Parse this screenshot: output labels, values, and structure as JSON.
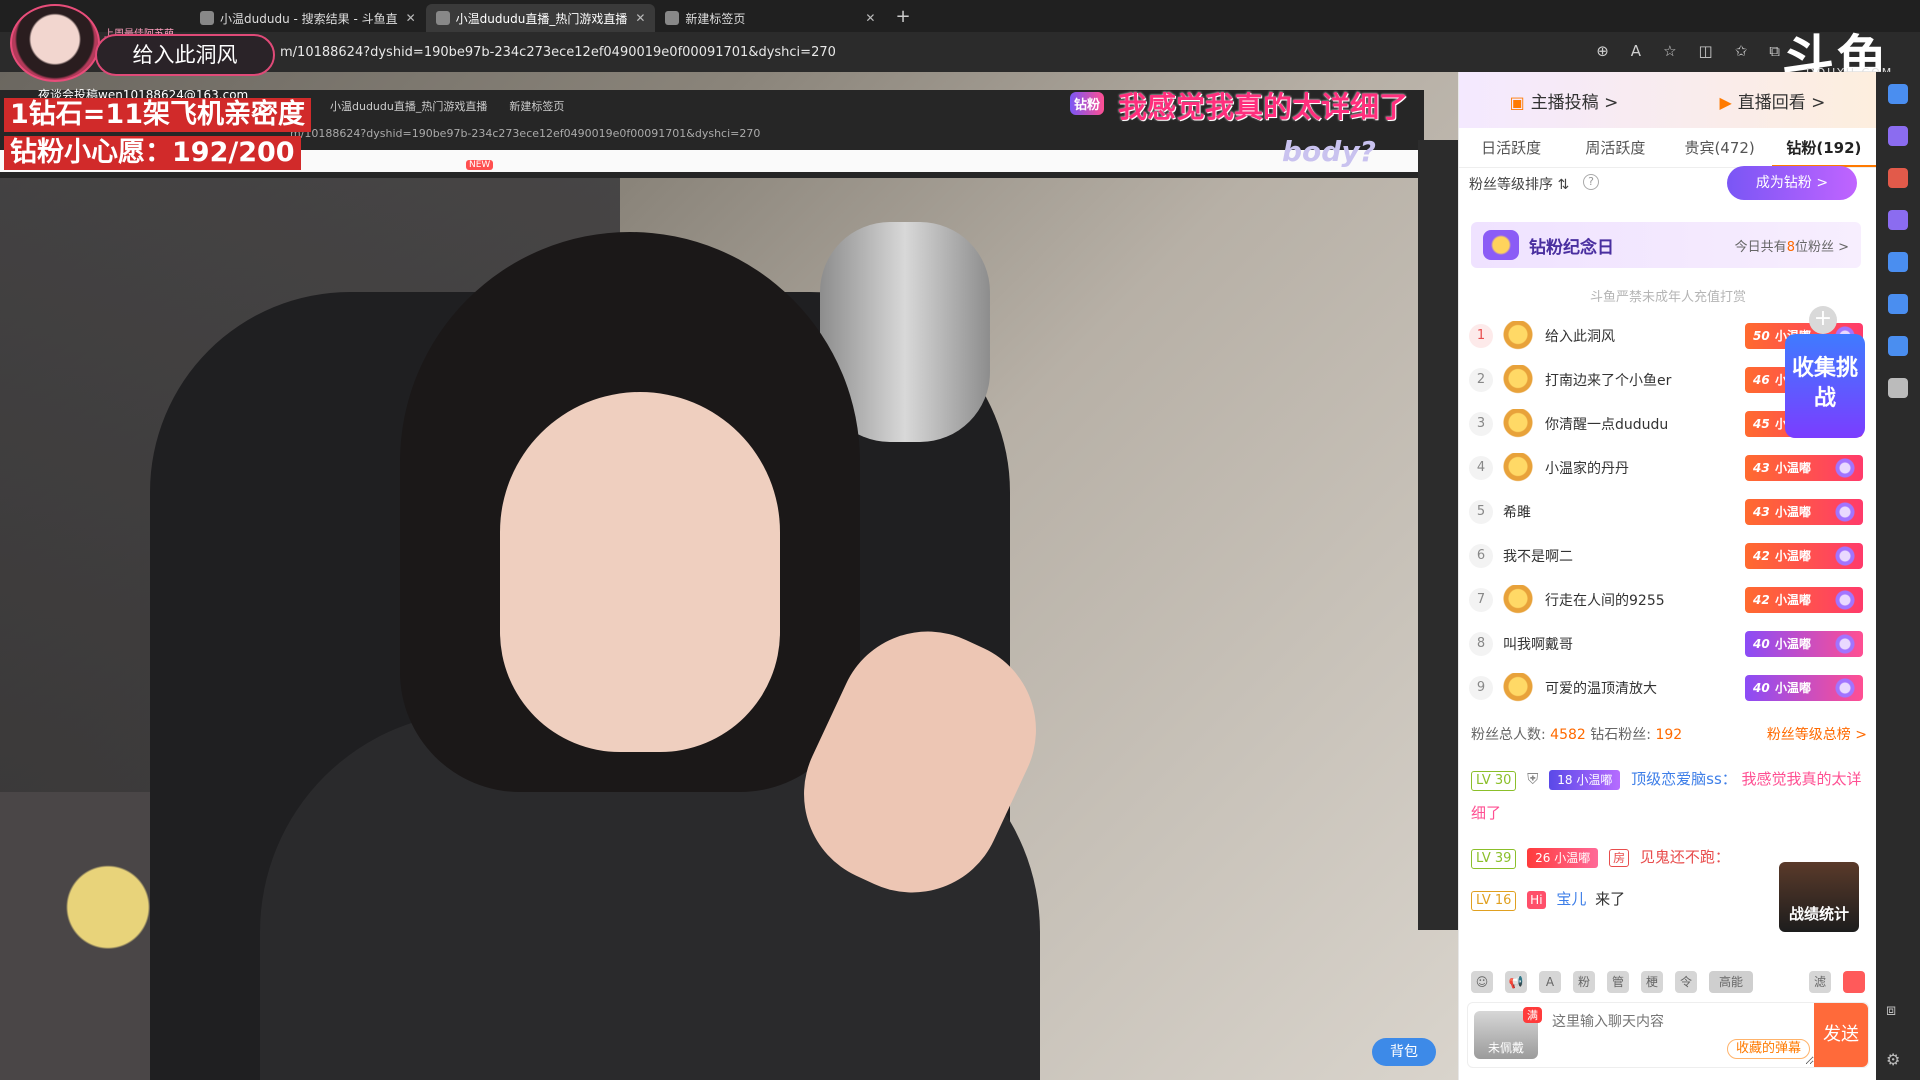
{
  "browser": {
    "tabs": [
      {
        "label": "小温dududu - 搜索结果 - 斗鱼直"
      },
      {
        "label": "小温dududu直播_热门游戏直播"
      },
      {
        "label": "新建标签页"
      }
    ],
    "new_tab": "+",
    "url": "m/10188624?dyshid=190be97b-234c273ece12ef0490019e0f00091701&dyshci=270"
  },
  "inner_browser": {
    "tabs": [
      "小温dududu直播_热门游戏直播",
      "新建标签页"
    ],
    "url": "m/10188624?dyshid=190be97b-234c273ece12ef0490019e0f00091701&dyshci=270",
    "new_badge": "NEW",
    "logo": "body?"
  },
  "overlay": {
    "name": "给入此洞风",
    "caption": "上周最佳阿苏萌",
    "email": "夜谈会投稿wen10188624@163.com",
    "promo_line1": "1钻石=11架飞机亲密度",
    "promo_line2": "钻粉小心愿：192/200",
    "danmu_badge": "钻粉",
    "danmu": "我感觉我真的太详细了",
    "brand_logo": "斗鱼",
    "brand_sub": "DOUYU.COM"
  },
  "video_controls": {
    "bag": "背包"
  },
  "panel": {
    "head": {
      "post": "主播投稿 >",
      "replay": "直播回看 >"
    },
    "tabs": [
      {
        "label": "日活跃度",
        "active": false
      },
      {
        "label": "周活跃度",
        "active": false
      },
      {
        "label": "贵宾(472)",
        "active": false
      },
      {
        "label": "钻粉(192)",
        "active": true
      }
    ],
    "rank_sort": "粉丝等级排序 ⇅",
    "help": "?",
    "become_button": "成为钻粉 >",
    "anniversary": {
      "title": "钻粉纪念日",
      "count_prefix": "今日共有",
      "count": "8",
      "count_suffix": "位粉丝 >"
    },
    "minor_warning": "斗鱼严禁未成年人充值打赏",
    "collect_widget": "收集挑战",
    "collect_plus": "+",
    "ranking": [
      {
        "rank": "1",
        "name": "给入此洞风",
        "level": "50",
        "badge": "小温嘟",
        "medal": true
      },
      {
        "rank": "2",
        "name": "打南边来了个小鱼er",
        "level": "46",
        "badge": "小温嘟",
        "medal": true
      },
      {
        "rank": "3",
        "name": "你清醒一点dududu",
        "level": "45",
        "badge": "小温嘟",
        "medal": true
      },
      {
        "rank": "4",
        "name": "小温家的丹丹",
        "level": "43",
        "badge": "小温嘟",
        "medal": true
      },
      {
        "rank": "5",
        "name": "希雎",
        "level": "43",
        "badge": "小温嘟",
        "medal": false
      },
      {
        "rank": "6",
        "name": "我不是啊二",
        "level": "42",
        "badge": "小温嘟",
        "medal": false
      },
      {
        "rank": "7",
        "name": "行走在人间的9255",
        "level": "42",
        "badge": "小温嘟",
        "medal": true
      },
      {
        "rank": "8",
        "name": "叫我啊戴哥",
        "level": "40",
        "badge": "小温嘟",
        "medal": false
      },
      {
        "rank": "9",
        "name": "可爱的温顶清放大",
        "level": "40",
        "badge": "小温嘟",
        "medal": true
      }
    ],
    "fans_summary": {
      "total_label": "粉丝总人数:",
      "total": "4582",
      "diamond_label": "钻石粉丝:",
      "diamond": "192",
      "link": "粉丝等级总榜 >"
    },
    "chat": [
      {
        "lv": "LV 30",
        "fan_level": "18",
        "fan_badge": "小温嘟",
        "user": "顶级恋爱脑ss：",
        "text": "我感觉我真的太详细了"
      },
      {
        "lv": "LV 39",
        "fan_level": "26",
        "fan_badge": "小温嘟",
        "room": "房",
        "user": "见鬼还不跑：",
        "text": ""
      },
      {
        "lv": "LV 16",
        "tag": "Hi",
        "user": "宝儿",
        "text": "来了"
      }
    ],
    "battle_stats": "战绩统计",
    "toolbar": [
      "☺",
      "📢",
      "A",
      "粉",
      "管",
      "梗",
      "令",
      "高能",
      "滤"
    ],
    "input": {
      "not_worn": "未佩戴",
      "full": "满",
      "placeholder": "这里输入聊天内容",
      "saved_danmu": "收藏的弹幕",
      "send": "发送"
    }
  }
}
